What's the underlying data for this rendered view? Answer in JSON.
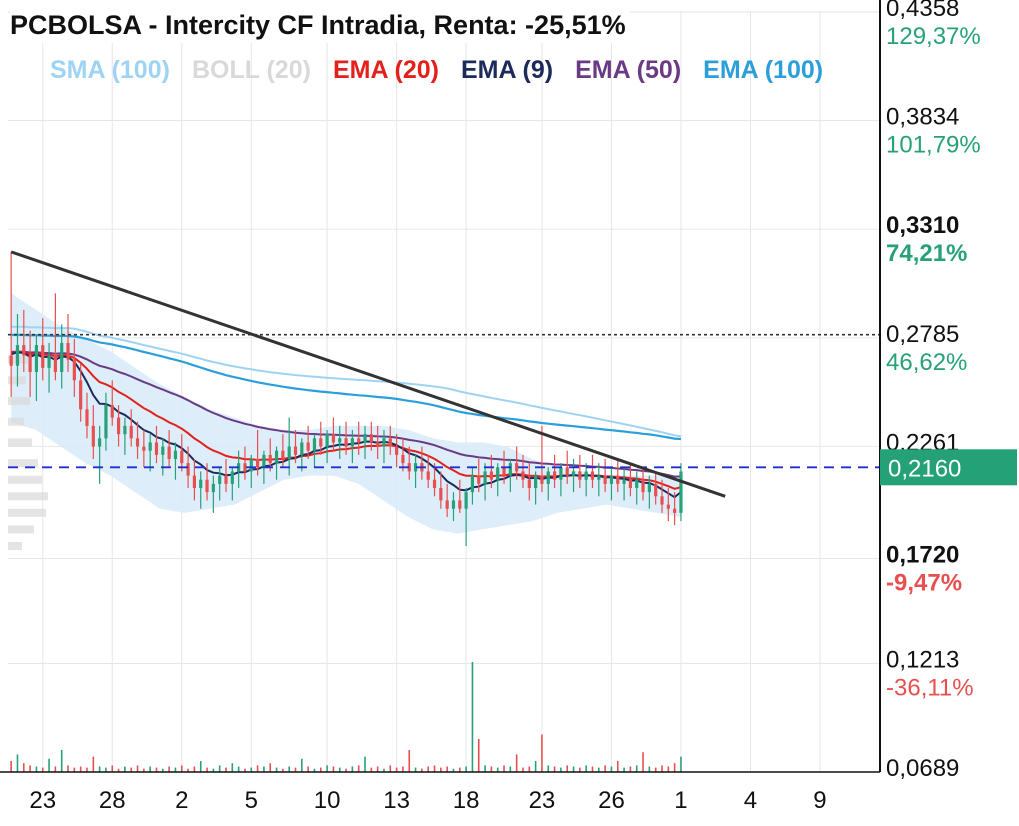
{
  "chart_title": "PCBOLSA - Intercity CF Intradia, Renta: -25,51%",
  "indicators": [
    {
      "label": "SMA (100)",
      "color": "#9fd3f3"
    },
    {
      "label": "BOLL (20)",
      "color": "#d9d9d9"
    },
    {
      "label": "EMA (20)",
      "color": "#e3201b"
    },
    {
      "label": "EMA (9)",
      "color": "#1d2a5c"
    },
    {
      "label": "EMA (50)",
      "color": "#6b3a85"
    },
    {
      "label": "EMA (100)",
      "color": "#2c9fdb"
    }
  ],
  "colors": {
    "up": "#26a17a",
    "down": "#e8504f",
    "price_badge": "#24a176",
    "trendline": "#333333",
    "current_price_line": "#1f2fd0",
    "reference_line": "#333333",
    "boll_fill": "#d7ebf9",
    "grid": "#e6e6e6"
  },
  "chart_data": {
    "type": "candlestick",
    "price_axis": {
      "ylim": [
        0.0689,
        0.4358
      ],
      "ticks": [
        {
          "value": 0.4358,
          "label": "0,4358",
          "pct": "129,37%",
          "pct_color": "#26a17a",
          "bold": false
        },
        {
          "value": 0.3834,
          "label": "0,3834",
          "pct": "101,79%",
          "pct_color": "#26a17a",
          "bold": false
        },
        {
          "value": 0.331,
          "label": "0,3310",
          "pct": "74,21%",
          "pct_color": "#26a17a",
          "bold": true
        },
        {
          "value": 0.2785,
          "label": "0,2785",
          "pct": "46,62%",
          "pct_color": "#26a17a",
          "bold": false
        },
        {
          "value": 0.2261,
          "label": "0,2261",
          "pct": "",
          "pct_color": "#26a17a",
          "bold": false
        },
        {
          "value": 0.172,
          "label": "0,1720",
          "pct": "-9,47%",
          "pct_color": "#e8504f",
          "bold": true
        },
        {
          "value": 0.1213,
          "label": "0,1213",
          "pct": "-36,11%",
          "pct_color": "#e8504f",
          "bold": false
        },
        {
          "value": 0.0689,
          "label": "0,0689",
          "pct": "",
          "pct_color": "#26a17a",
          "bold": false
        }
      ],
      "current_price": 0.216,
      "current_price_label": "0,2160",
      "reference_price": 0.28
    },
    "x_axis": {
      "tick_labels": [
        "23",
        "28",
        "2",
        "5",
        "10",
        "13",
        "18",
        "23",
        "26",
        "1",
        "4",
        "9"
      ],
      "tick_index": [
        5,
        16,
        27,
        38,
        50,
        61,
        72,
        84,
        95,
        106,
        117,
        128
      ],
      "total_slots": 138
    },
    "candles": [
      [
        0.27,
        0.32,
        0.25,
        0.265
      ],
      [
        0.265,
        0.29,
        0.255,
        0.275
      ],
      [
        0.275,
        0.292,
        0.262,
        0.27
      ],
      [
        0.27,
        0.282,
        0.25,
        0.262
      ],
      [
        0.262,
        0.28,
        0.248,
        0.275
      ],
      [
        0.275,
        0.288,
        0.258,
        0.264
      ],
      [
        0.264,
        0.276,
        0.252,
        0.27
      ],
      [
        0.27,
        0.3,
        0.258,
        0.262
      ],
      [
        0.262,
        0.285,
        0.254,
        0.276
      ],
      [
        0.276,
        0.29,
        0.262,
        0.268
      ],
      [
        0.268,
        0.278,
        0.25,
        0.258
      ],
      [
        0.258,
        0.266,
        0.238,
        0.244
      ],
      [
        0.244,
        0.252,
        0.23,
        0.236
      ],
      [
        0.236,
        0.246,
        0.22,
        0.226
      ],
      [
        0.226,
        0.236,
        0.208,
        0.23
      ],
      [
        0.23,
        0.252,
        0.224,
        0.246
      ],
      [
        0.246,
        0.258,
        0.236,
        0.24
      ],
      [
        0.24,
        0.246,
        0.226,
        0.232
      ],
      [
        0.232,
        0.24,
        0.222,
        0.236
      ],
      [
        0.236,
        0.244,
        0.226,
        0.23
      ],
      [
        0.23,
        0.238,
        0.22,
        0.226
      ],
      [
        0.226,
        0.234,
        0.216,
        0.224
      ],
      [
        0.224,
        0.232,
        0.214,
        0.228
      ],
      [
        0.228,
        0.236,
        0.218,
        0.222
      ],
      [
        0.222,
        0.23,
        0.212,
        0.226
      ],
      [
        0.226,
        0.234,
        0.216,
        0.22
      ],
      [
        0.22,
        0.228,
        0.21,
        0.224
      ],
      [
        0.224,
        0.232,
        0.214,
        0.218
      ],
      [
        0.218,
        0.226,
        0.206,
        0.212
      ],
      [
        0.212,
        0.22,
        0.2,
        0.206
      ],
      [
        0.206,
        0.214,
        0.196,
        0.21
      ],
      [
        0.21,
        0.218,
        0.2,
        0.204
      ],
      [
        0.204,
        0.212,
        0.194,
        0.208
      ],
      [
        0.208,
        0.216,
        0.2,
        0.212
      ],
      [
        0.212,
        0.22,
        0.204,
        0.208
      ],
      [
        0.208,
        0.216,
        0.2,
        0.214
      ],
      [
        0.214,
        0.224,
        0.206,
        0.218
      ],
      [
        0.218,
        0.226,
        0.21,
        0.214
      ],
      [
        0.214,
        0.222,
        0.206,
        0.22
      ],
      [
        0.22,
        0.234,
        0.212,
        0.216
      ],
      [
        0.216,
        0.224,
        0.208,
        0.222
      ],
      [
        0.222,
        0.23,
        0.214,
        0.218
      ],
      [
        0.218,
        0.226,
        0.21,
        0.224
      ],
      [
        0.224,
        0.232,
        0.216,
        0.22
      ],
      [
        0.22,
        0.24,
        0.212,
        0.226
      ],
      [
        0.226,
        0.234,
        0.218,
        0.222
      ],
      [
        0.222,
        0.23,
        0.214,
        0.228
      ],
      [
        0.228,
        0.236,
        0.22,
        0.224
      ],
      [
        0.224,
        0.232,
        0.216,
        0.23
      ],
      [
        0.23,
        0.238,
        0.222,
        0.226
      ],
      [
        0.226,
        0.234,
        0.218,
        0.232
      ],
      [
        0.232,
        0.24,
        0.224,
        0.228
      ],
      [
        0.228,
        0.236,
        0.22,
        0.23
      ],
      [
        0.23,
        0.238,
        0.222,
        0.226
      ],
      [
        0.226,
        0.234,
        0.218,
        0.23
      ],
      [
        0.23,
        0.238,
        0.222,
        0.228
      ],
      [
        0.228,
        0.236,
        0.22,
        0.232
      ],
      [
        0.232,
        0.238,
        0.224,
        0.228
      ],
      [
        0.228,
        0.236,
        0.22,
        0.226
      ],
      [
        0.226,
        0.234,
        0.218,
        0.23
      ],
      [
        0.23,
        0.236,
        0.222,
        0.226
      ],
      [
        0.226,
        0.232,
        0.216,
        0.222
      ],
      [
        0.222,
        0.23,
        0.214,
        0.218
      ],
      [
        0.218,
        0.226,
        0.21,
        0.214
      ],
      [
        0.214,
        0.222,
        0.206,
        0.218
      ],
      [
        0.218,
        0.226,
        0.21,
        0.214
      ],
      [
        0.214,
        0.222,
        0.206,
        0.21
      ],
      [
        0.21,
        0.218,
        0.202,
        0.206
      ],
      [
        0.206,
        0.214,
        0.196,
        0.2
      ],
      [
        0.2,
        0.208,
        0.192,
        0.196
      ],
      [
        0.196,
        0.204,
        0.19,
        0.2
      ],
      [
        0.2,
        0.21,
        0.194,
        0.196
      ],
      [
        0.196,
        0.206,
        0.178,
        0.204
      ],
      [
        0.204,
        0.216,
        0.198,
        0.212
      ],
      [
        0.212,
        0.22,
        0.204,
        0.208
      ],
      [
        0.208,
        0.218,
        0.2,
        0.214
      ],
      [
        0.214,
        0.222,
        0.206,
        0.21
      ],
      [
        0.21,
        0.218,
        0.202,
        0.216
      ],
      [
        0.216,
        0.224,
        0.208,
        0.212
      ],
      [
        0.212,
        0.22,
        0.204,
        0.218
      ],
      [
        0.218,
        0.226,
        0.21,
        0.214
      ],
      [
        0.214,
        0.222,
        0.206,
        0.21
      ],
      [
        0.21,
        0.218,
        0.2,
        0.206
      ],
      [
        0.206,
        0.214,
        0.198,
        0.212
      ],
      [
        0.212,
        0.236,
        0.204,
        0.208
      ],
      [
        0.208,
        0.216,
        0.2,
        0.214
      ],
      [
        0.214,
        0.222,
        0.206,
        0.21
      ],
      [
        0.21,
        0.218,
        0.202,
        0.216
      ],
      [
        0.216,
        0.224,
        0.208,
        0.212
      ],
      [
        0.212,
        0.22,
        0.204,
        0.214
      ],
      [
        0.214,
        0.222,
        0.206,
        0.21
      ],
      [
        0.21,
        0.218,
        0.202,
        0.214
      ],
      [
        0.214,
        0.222,
        0.206,
        0.21
      ],
      [
        0.21,
        0.218,
        0.202,
        0.212
      ],
      [
        0.212,
        0.22,
        0.204,
        0.208
      ],
      [
        0.208,
        0.216,
        0.2,
        0.212
      ],
      [
        0.212,
        0.22,
        0.204,
        0.208
      ],
      [
        0.208,
        0.216,
        0.2,
        0.21
      ],
      [
        0.21,
        0.218,
        0.202,
        0.206
      ],
      [
        0.206,
        0.214,
        0.198,
        0.21
      ],
      [
        0.21,
        0.216,
        0.2,
        0.204
      ],
      [
        0.204,
        0.212,
        0.196,
        0.208
      ],
      [
        0.208,
        0.214,
        0.198,
        0.202
      ],
      [
        0.202,
        0.21,
        0.194,
        0.198
      ],
      [
        0.198,
        0.206,
        0.19,
        0.196
      ],
      [
        0.196,
        0.204,
        0.188,
        0.194
      ],
      [
        0.194,
        0.218,
        0.19,
        0.214
      ]
    ],
    "volumes": [
      0.1,
      0.16,
      0.08,
      0.06,
      0.05,
      0.04,
      0.12,
      0.05,
      0.2,
      0.06,
      0.04,
      0.05,
      0.04,
      0.14,
      0.05,
      0.04,
      0.06,
      0.03,
      0.05,
      0.04,
      0.06,
      0.03,
      0.05,
      0.04,
      0.03,
      0.05,
      0.04,
      0.06,
      0.03,
      0.05,
      0.1,
      0.04,
      0.03,
      0.06,
      0.04,
      0.08,
      0.05,
      0.03,
      0.04,
      0.06,
      0.05,
      0.08,
      0.04,
      0.03,
      0.05,
      0.04,
      0.12,
      0.05,
      0.03,
      0.04,
      0.06,
      0.05,
      0.04,
      0.03,
      0.05,
      0.06,
      0.14,
      0.04,
      0.05,
      0.03,
      0.06,
      0.04,
      0.05,
      0.2,
      0.04,
      0.03,
      0.05,
      0.06,
      0.04,
      0.05,
      0.03,
      0.04,
      0.05,
      1.0,
      0.3,
      0.06,
      0.05,
      0.04,
      0.06,
      0.05,
      0.16,
      0.04,
      0.05,
      0.1,
      0.34,
      0.06,
      0.05,
      0.04,
      0.06,
      0.05,
      0.04,
      0.06,
      0.05,
      0.04,
      0.06,
      0.05,
      0.1,
      0.04,
      0.05,
      0.06,
      0.18,
      0.05,
      0.04,
      0.06,
      0.05,
      0.08,
      0.14,
      0.3
    ],
    "trendline": [
      {
        "i": 0,
        "price": 0.32
      },
      {
        "i": 113,
        "price": 0.202
      }
    ],
    "boll_upper": [
      0.3,
      0.292,
      0.284,
      0.278,
      0.272,
      0.264,
      0.256,
      0.25,
      0.244,
      0.24,
      0.236,
      0.234,
      0.234,
      0.236,
      0.236,
      0.236,
      0.234,
      0.23,
      0.228,
      0.228,
      0.226,
      0.22,
      0.216,
      0.214,
      0.212,
      0.212,
      0.212,
      0.212
    ],
    "boll_lower": [
      0.238,
      0.234,
      0.226,
      0.218,
      0.212,
      0.204,
      0.196,
      0.194,
      0.196,
      0.198,
      0.204,
      0.21,
      0.212,
      0.212,
      0.208,
      0.2,
      0.192,
      0.186,
      0.184,
      0.186,
      0.188,
      0.19,
      0.194,
      0.196,
      0.198,
      0.196,
      0.194,
      0.192
    ]
  }
}
